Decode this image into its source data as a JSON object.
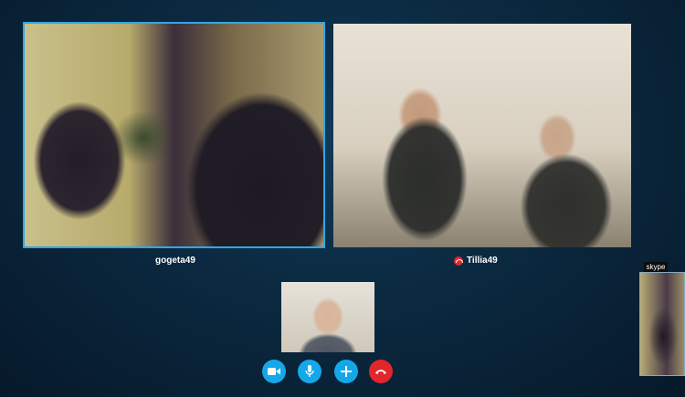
{
  "participants": [
    {
      "name": "gogeta49",
      "status": ""
    },
    {
      "name": "Tillia49",
      "status": "hung-up"
    }
  ],
  "self_view": {
    "label": ""
  },
  "controls": {
    "video": "video-camera-icon",
    "mic": "microphone-icon",
    "add": "plus-icon",
    "end": "end-call-icon"
  },
  "mini_window": {
    "logo": "skype"
  },
  "colors": {
    "accent": "#14a8e8",
    "end_call": "#e2262c",
    "active_border": "#2fa8e6"
  }
}
